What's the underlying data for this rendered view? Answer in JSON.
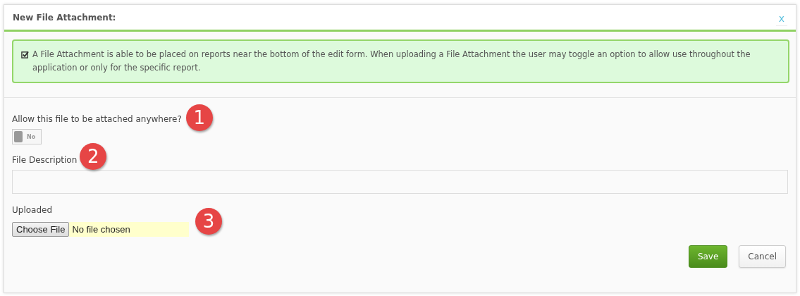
{
  "dialog": {
    "title": "New File Attachment:",
    "close": "x"
  },
  "notice": {
    "text": "A File Attachment is able to be placed on reports near the bottom of the edit form. When uploading a File Attachment the user may toggle an option to allow use throughout the application or only for the specific report."
  },
  "fields": [
    {
      "kind": "toggle",
      "label": "Allow this file to be attached anywhere?",
      "on": false,
      "state_text": "No",
      "callout": "1"
    },
    {
      "kind": "text",
      "label": "File Description",
      "callout": "2"
    },
    {
      "kind": "file",
      "label": "Uploaded",
      "button": "Choose File",
      "status": "No file chosen",
      "callout": "3"
    }
  ],
  "buttons": [
    {
      "label": "Save",
      "kind": "primary"
    },
    {
      "label": "Cancel",
      "kind": "secondary"
    }
  ]
}
